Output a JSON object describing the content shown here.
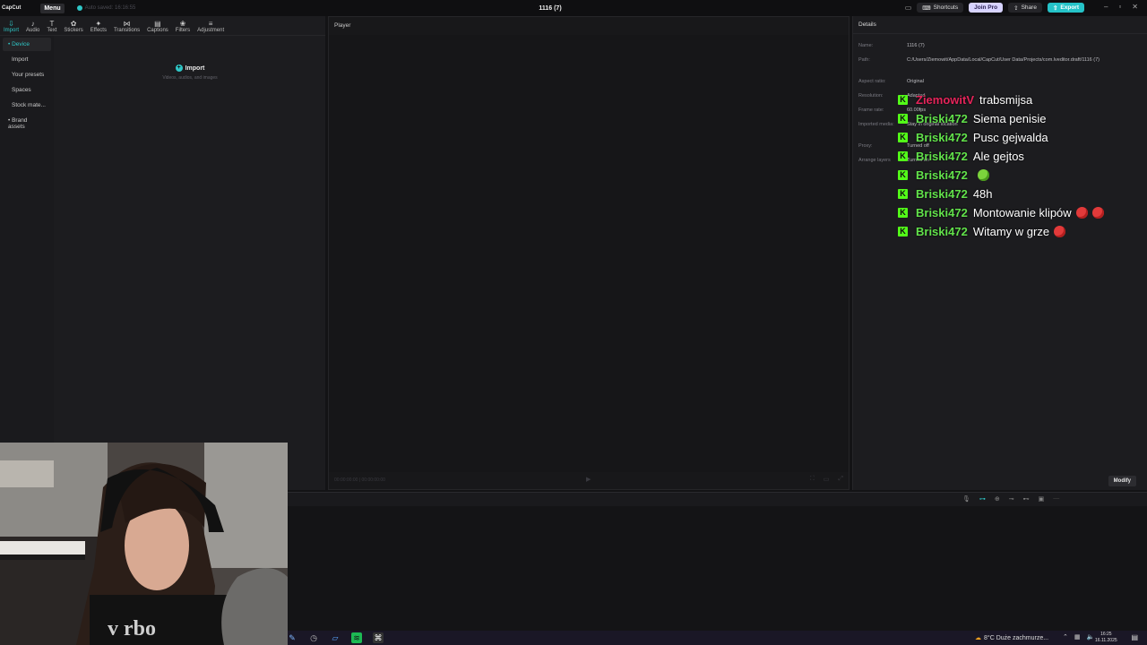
{
  "app": {
    "logo": "CapCut",
    "menu_label": "Menu",
    "autosave": "Auto saved: 16:16:55",
    "project_title": "1116 (7)",
    "shortcuts": "Shortcuts",
    "join_pro": "Join Pro",
    "share": "Share",
    "export": "Export"
  },
  "toolbar": [
    {
      "label": "Import",
      "icon": "⇩"
    },
    {
      "label": "Audio",
      "icon": "♪"
    },
    {
      "label": "Text",
      "icon": "T"
    },
    {
      "label": "Stickers",
      "icon": "✿"
    },
    {
      "label": "Effects",
      "icon": "✦"
    },
    {
      "label": "Transitions",
      "icon": "⋈"
    },
    {
      "label": "Captions",
      "icon": "▤"
    },
    {
      "label": "Filters",
      "icon": "❀"
    },
    {
      "label": "Adjustment",
      "icon": "≡"
    }
  ],
  "leftnav": {
    "device": "• Device",
    "import": "Import",
    "presets": "Your presets",
    "spaces": "Spaces",
    "stock": "Stock mate...",
    "brand": "• Brand assets"
  },
  "media": {
    "import_title": "Import",
    "import_sub": "Videos, audios, and images"
  },
  "player": {
    "title": "Player",
    "timecode": "00:00:00:00 | 00:00:00:00"
  },
  "details": {
    "title": "Details",
    "name_label": "Name:",
    "name_value": "1116 (7)",
    "path_label": "Path:",
    "path_value": "C:/Users/Ziemowit/AppData/Local/CapCut/User Data/Projects/com.lveditor.draft/1116 (7)",
    "aspect_label": "Aspect ratio:",
    "aspect_value": "Original",
    "resolution_label": "Resolution:",
    "resolution_value": "Adapted",
    "framerate_label": "Frame rate:",
    "framerate_value": "60.00fps",
    "imported_label": "Imported media:",
    "imported_value": "Stay in original location",
    "proxy_label": "Proxy:",
    "proxy_value": "Turned off",
    "arrange_label": "Arrange layers",
    "arrange_value": "Turned on",
    "modify": "Modify"
  },
  "taskbar": {
    "weather": "8°C  Duże zachmurze...",
    "time": "16:25",
    "date": "16.11.2025"
  },
  "chat": [
    {
      "user": "ZiemowitV",
      "msg": "trabsmijsa",
      "user_color": "red",
      "emotes": []
    },
    {
      "user": "Briski472",
      "msg": "Siema penisie",
      "user_color": "green",
      "emotes": []
    },
    {
      "user": "Briski472",
      "msg": "Pusc gejwalda",
      "user_color": "green",
      "emotes": []
    },
    {
      "user": "Briski472",
      "msg": "Ale gejtos",
      "user_color": "green",
      "emotes": []
    },
    {
      "user": "Briski472",
      "msg": "",
      "user_color": "green",
      "emotes": [
        "green"
      ]
    },
    {
      "user": "Briski472",
      "msg": "48h",
      "user_color": "green",
      "emotes": []
    },
    {
      "user": "Briski472",
      "msg": "Montowanie klipów",
      "user_color": "green",
      "emotes": [
        "devil",
        "devil"
      ]
    },
    {
      "user": "Briski472",
      "msg": "Witamy w grze",
      "user_color": "green",
      "emotes": [
        "devil"
      ]
    }
  ]
}
